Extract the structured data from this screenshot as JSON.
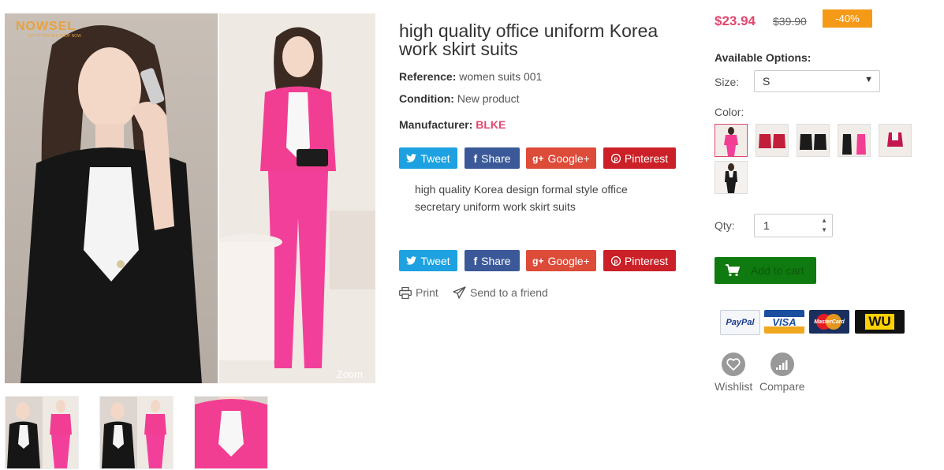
{
  "gallery": {
    "brand_logo": "NOWSEL",
    "brand_tagline": "UP TO 70% OFF SHOP NOW",
    "zoom_label": "Zoom",
    "thumbnails": [
      "thumb-1",
      "thumb-2",
      "thumb-3"
    ]
  },
  "product": {
    "title": "high quality office uniform Korea work skirt suits",
    "reference_label": "Reference:",
    "reference_value": "women suits 001",
    "condition_label": "Condition:",
    "condition_value": "New product",
    "manufacturer_label": "Manufacturer:",
    "manufacturer_value": "BLKE",
    "description": "high quality Korea design formal style office secretary uniform work skirt suits"
  },
  "share": {
    "tweet": "Tweet",
    "facebook": "Share",
    "google": "Google+",
    "pinterest": "Pinterest"
  },
  "actions": {
    "print": "Print",
    "send_friend": "Send to a friend"
  },
  "pricing": {
    "price": "$23.94",
    "old_price": "$39.90",
    "discount": "-40%"
  },
  "options": {
    "title": "Available Options:",
    "size_label": "Size:",
    "size_value": "S",
    "color_label": "Color:",
    "qty_label": "Qty:",
    "qty_value": "1",
    "add_to_cart": "Add to cart"
  },
  "payments": {
    "paypal": "PayPal",
    "visa": "VISA",
    "mastercard": "MasterCard",
    "wu": "WU"
  },
  "extra": {
    "wishlist": "Wishlist",
    "compare": "Compare"
  },
  "colors": {
    "accent_pink": "#e0476f",
    "discount_orange": "#f59a17",
    "cart_green": "#0f7a0f",
    "twitter": "#1da1e0",
    "facebook": "#3b5998",
    "google": "#dd4b39",
    "pinterest": "#cb2027"
  }
}
